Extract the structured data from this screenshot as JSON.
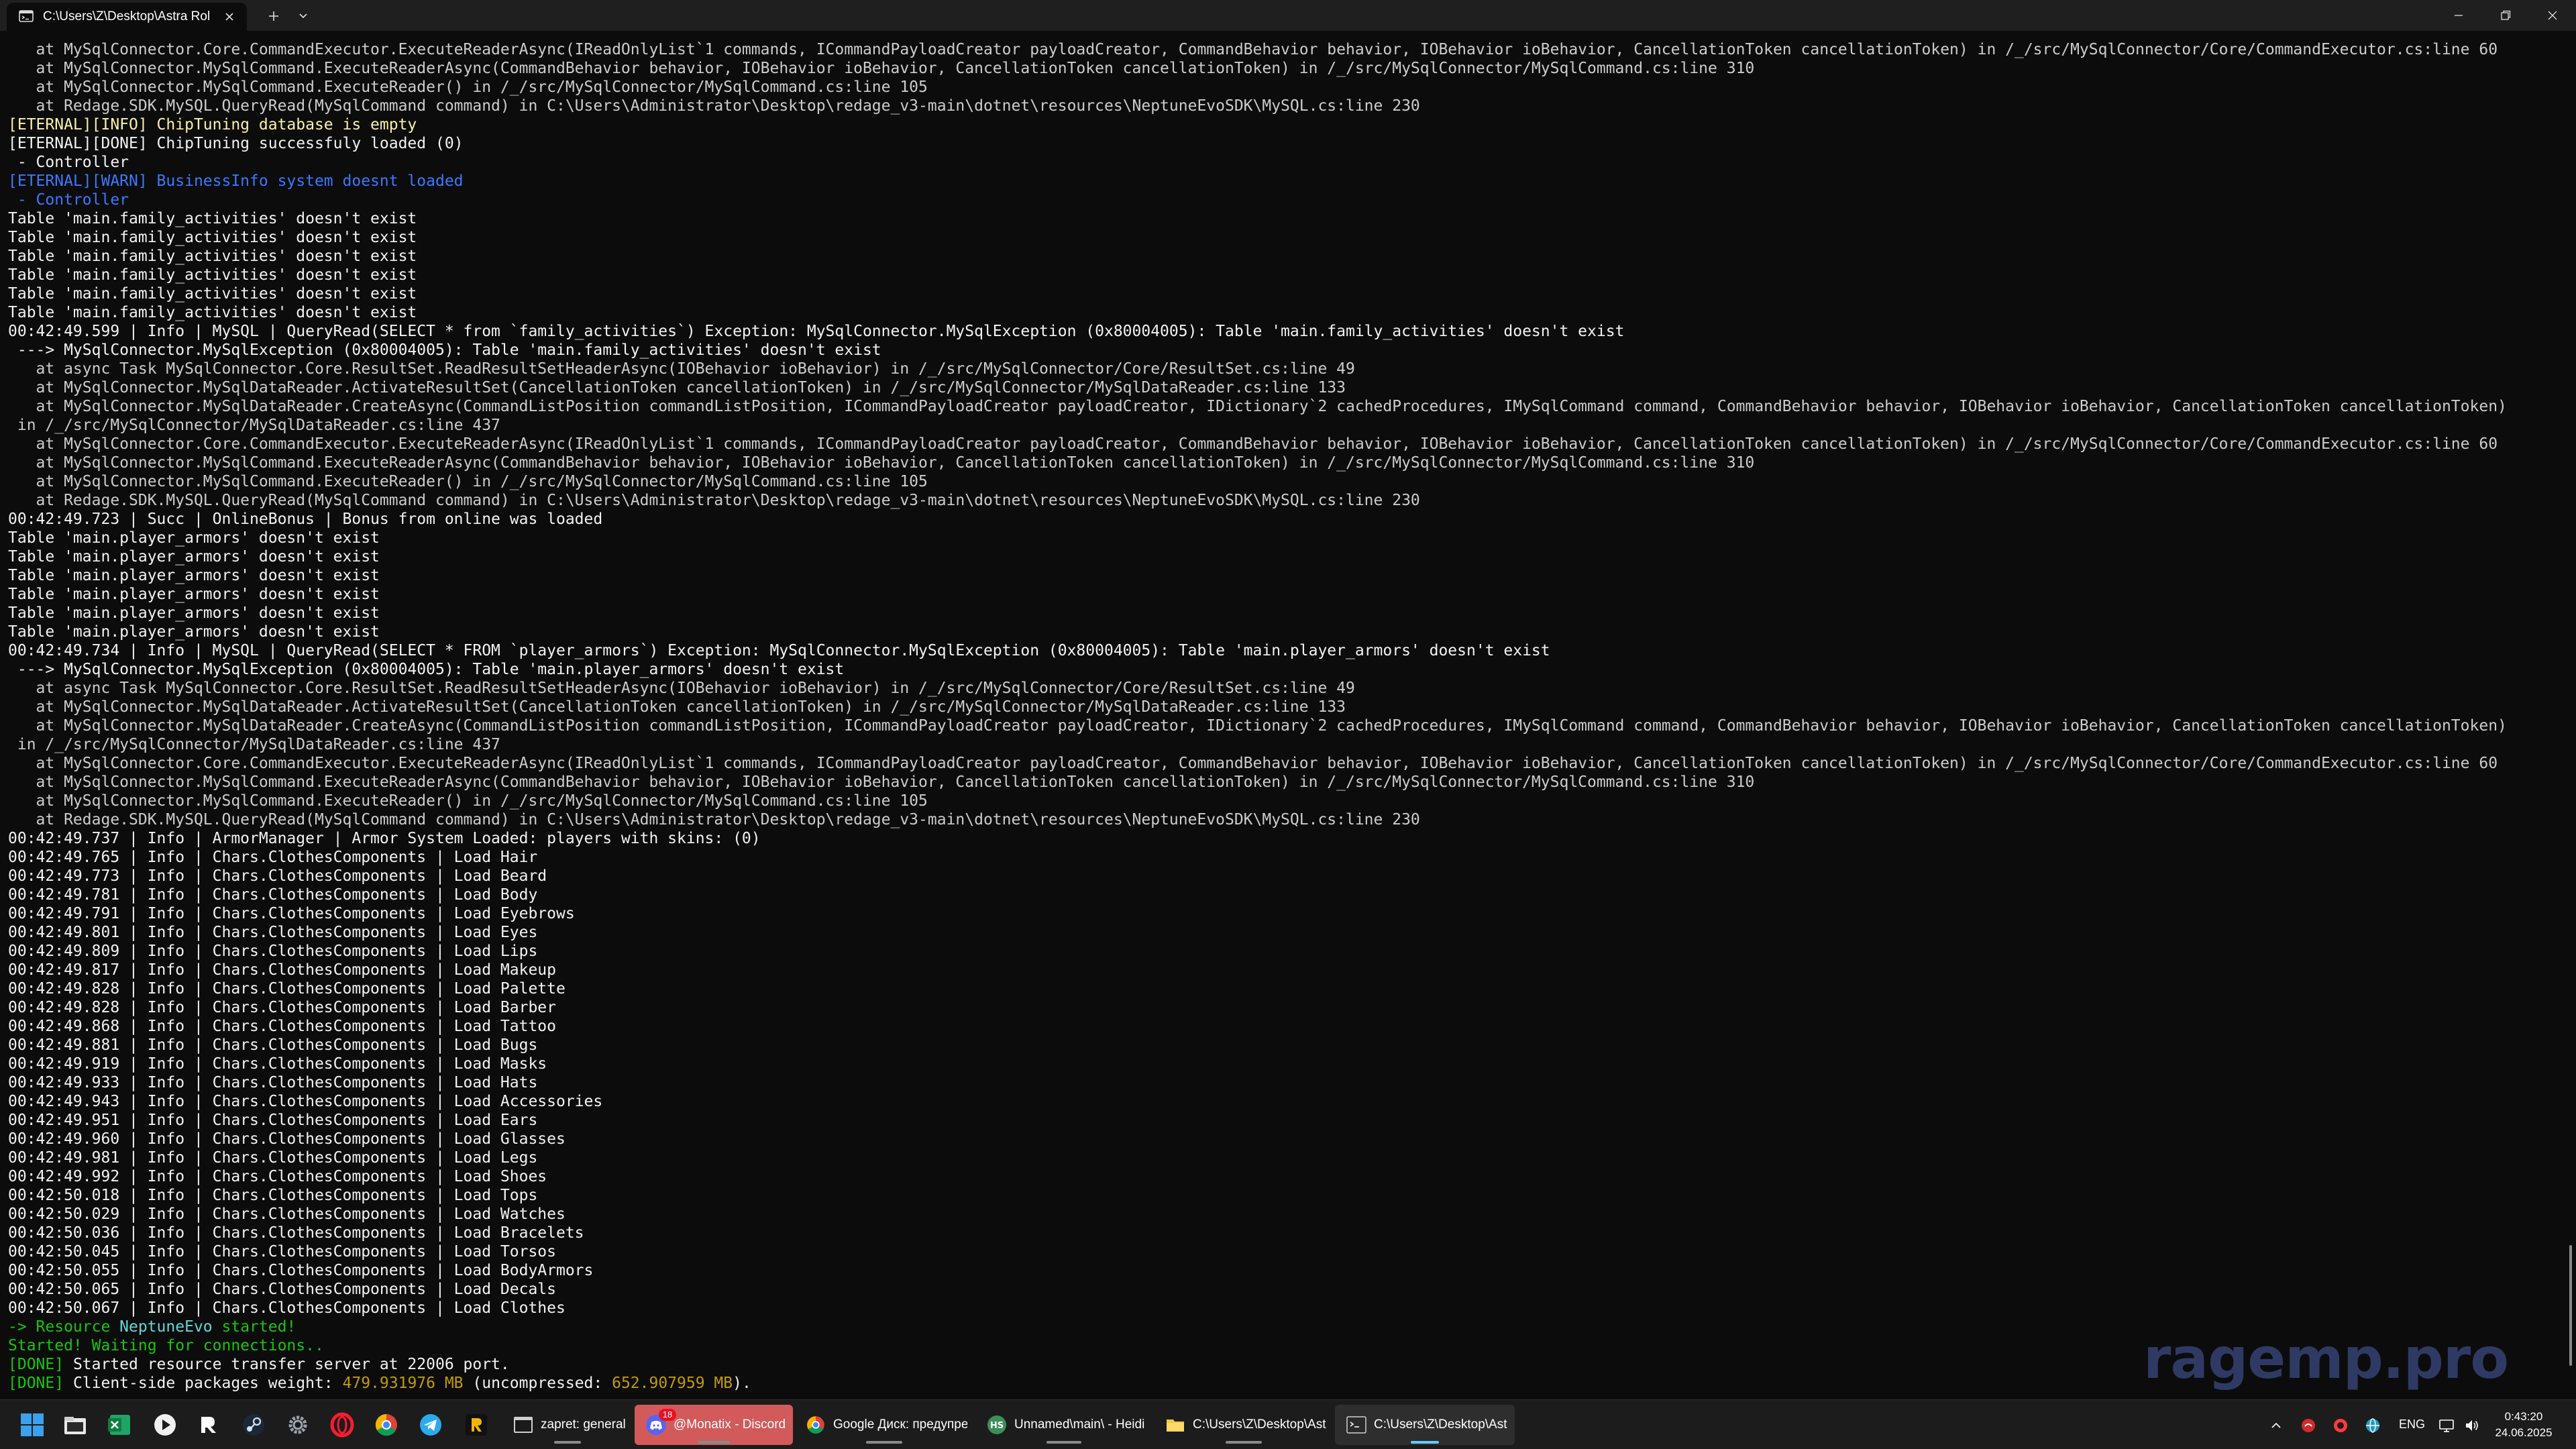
{
  "window": {
    "tab_title": "C:\\Users\\Z\\Desktop\\Astra Rol",
    "tab_icon": "terminal-icon"
  },
  "console": {
    "lines": [
      {
        "c": "default",
        "t": "   at MySqlConnector.Core.CommandExecutor.ExecuteReaderAsync(IReadOnlyList`1 commands, ICommandPayloadCreator payloadCreator, CommandBehavior behavior, IOBehavior ioBehavior, CancellationToken cancellationToken) in /_/src/MySqlConnector/Core/CommandExecutor.cs:line 60"
      },
      {
        "c": "default",
        "t": "   at MySqlConnector.MySqlCommand.ExecuteReaderAsync(CommandBehavior behavior, IOBehavior ioBehavior, CancellationToken cancellationToken) in /_/src/MySqlConnector/MySqlCommand.cs:line 310"
      },
      {
        "c": "default",
        "t": "   at MySqlConnector.MySqlCommand.ExecuteReader() in /_/src/MySqlConnector/MySqlCommand.cs:line 105"
      },
      {
        "c": "default",
        "t": "   at Redage.SDK.MySQL.QueryRead(MySqlCommand command) in C:\\Users\\Administrator\\Desktop\\redage_v3-main\\dotnet\\resources\\NeptuneEvoSDK\\MySQL.cs:line 230"
      },
      {
        "c": "yellow",
        "t": "[ETERNAL][INFO] ChipTuning database is empty"
      },
      {
        "c": "white",
        "t": "[ETERNAL][DONE] ChipTuning successfuly loaded (0)"
      },
      {
        "c": "white",
        "t": " - Controller"
      },
      {
        "c": "blue",
        "t": "[ETERNAL][WARN] BusinessInfo system doesnt loaded"
      },
      {
        "c": "blue",
        "t": " - Controller"
      },
      {
        "c": "white",
        "t": "Table 'main.family_activities' doesn't exist"
      },
      {
        "c": "white",
        "t": "Table 'main.family_activities' doesn't exist"
      },
      {
        "c": "white",
        "t": "Table 'main.family_activities' doesn't exist"
      },
      {
        "c": "white",
        "t": "Table 'main.family_activities' doesn't exist"
      },
      {
        "c": "white",
        "t": "Table 'main.family_activities' doesn't exist"
      },
      {
        "c": "white",
        "t": "Table 'main.family_activities' doesn't exist"
      },
      {
        "c": "white",
        "t": "00:42:49.599 | Info | MySQL | QueryRead(SELECT * from `family_activities`) Exception: MySqlConnector.MySqlException (0x80004005): Table 'main.family_activities' doesn't exist"
      },
      {
        "c": "white",
        "t": " ---> MySqlConnector.MySqlException (0x80004005): Table 'main.family_activities' doesn't exist"
      },
      {
        "c": "default",
        "t": "   at async Task MySqlConnector.Core.ResultSet.ReadResultSetHeaderAsync(IOBehavior ioBehavior) in /_/src/MySqlConnector/Core/ResultSet.cs:line 49"
      },
      {
        "c": "default",
        "t": "   at MySqlConnector.MySqlDataReader.ActivateResultSet(CancellationToken cancellationToken) in /_/src/MySqlConnector/MySqlDataReader.cs:line 133"
      },
      {
        "c": "default",
        "t": "   at MySqlConnector.MySqlDataReader.CreateAsync(CommandListPosition commandListPosition, ICommandPayloadCreator payloadCreator, IDictionary`2 cachedProcedures, IMySqlCommand command, CommandBehavior behavior, IOBehavior ioBehavior, CancellationToken cancellationToken)"
      },
      {
        "c": "default",
        "t": " in /_/src/MySqlConnector/MySqlDataReader.cs:line 437"
      },
      {
        "c": "default",
        "t": "   at MySqlConnector.Core.CommandExecutor.ExecuteReaderAsync(IReadOnlyList`1 commands, ICommandPayloadCreator payloadCreator, CommandBehavior behavior, IOBehavior ioBehavior, CancellationToken cancellationToken) in /_/src/MySqlConnector/Core/CommandExecutor.cs:line 60"
      },
      {
        "c": "default",
        "t": "   at MySqlConnector.MySqlCommand.ExecuteReaderAsync(CommandBehavior behavior, IOBehavior ioBehavior, CancellationToken cancellationToken) in /_/src/MySqlConnector/MySqlCommand.cs:line 310"
      },
      {
        "c": "default",
        "t": "   at MySqlConnector.MySqlCommand.ExecuteReader() in /_/src/MySqlConnector/MySqlCommand.cs:line 105"
      },
      {
        "c": "default",
        "t": "   at Redage.SDK.MySQL.QueryRead(MySqlCommand command) in C:\\Users\\Administrator\\Desktop\\redage_v3-main\\dotnet\\resources\\NeptuneEvoSDK\\MySQL.cs:line 230"
      },
      {
        "c": "white",
        "t": "00:42:49.723 | Succ | OnlineBonus | Bonus from online was loaded"
      },
      {
        "c": "white",
        "t": "Table 'main.player_armors' doesn't exist"
      },
      {
        "c": "white",
        "t": "Table 'main.player_armors' doesn't exist"
      },
      {
        "c": "white",
        "t": "Table 'main.player_armors' doesn't exist"
      },
      {
        "c": "white",
        "t": "Table 'main.player_armors' doesn't exist"
      },
      {
        "c": "white",
        "t": "Table 'main.player_armors' doesn't exist"
      },
      {
        "c": "white",
        "t": "Table 'main.player_armors' doesn't exist"
      },
      {
        "c": "white",
        "t": "00:42:49.734 | Info | MySQL | QueryRead(SELECT * FROM `player_armors`) Exception: MySqlConnector.MySqlException (0x80004005): Table 'main.player_armors' doesn't exist"
      },
      {
        "c": "white",
        "t": " ---> MySqlConnector.MySqlException (0x80004005): Table 'main.player_armors' doesn't exist"
      },
      {
        "c": "default",
        "t": "   at async Task MySqlConnector.Core.ResultSet.ReadResultSetHeaderAsync(IOBehavior ioBehavior) in /_/src/MySqlConnector/Core/ResultSet.cs:line 49"
      },
      {
        "c": "default",
        "t": "   at MySqlConnector.MySqlDataReader.ActivateResultSet(CancellationToken cancellationToken) in /_/src/MySqlConnector/MySqlDataReader.cs:line 133"
      },
      {
        "c": "default",
        "t": "   at MySqlConnector.MySqlDataReader.CreateAsync(CommandListPosition commandListPosition, ICommandPayloadCreator payloadCreator, IDictionary`2 cachedProcedures, IMySqlCommand command, CommandBehavior behavior, IOBehavior ioBehavior, CancellationToken cancellationToken)"
      },
      {
        "c": "default",
        "t": " in /_/src/MySqlConnector/MySqlDataReader.cs:line 437"
      },
      {
        "c": "default",
        "t": "   at MySqlConnector.Core.CommandExecutor.ExecuteReaderAsync(IReadOnlyList`1 commands, ICommandPayloadCreator payloadCreator, CommandBehavior behavior, IOBehavior ioBehavior, CancellationToken cancellationToken) in /_/src/MySqlConnector/Core/CommandExecutor.cs:line 60"
      },
      {
        "c": "default",
        "t": "   at MySqlConnector.MySqlCommand.ExecuteReaderAsync(CommandBehavior behavior, IOBehavior ioBehavior, CancellationToken cancellationToken) in /_/src/MySqlConnector/MySqlCommand.cs:line 310"
      },
      {
        "c": "default",
        "t": "   at MySqlConnector.MySqlCommand.ExecuteReader() in /_/src/MySqlConnector/MySqlCommand.cs:line 105"
      },
      {
        "c": "default",
        "t": "   at Redage.SDK.MySQL.QueryRead(MySqlCommand command) in C:\\Users\\Administrator\\Desktop\\redage_v3-main\\dotnet\\resources\\NeptuneEvoSDK\\MySQL.cs:line 230"
      },
      {
        "c": "white",
        "t": "00:42:49.737 | Info | ArmorManager | Armor System Loaded: players with skins: (0)"
      },
      {
        "c": "white",
        "t": "00:42:49.765 | Info | Chars.ClothesComponents | Load Hair"
      },
      {
        "c": "white",
        "t": "00:42:49.773 | Info | Chars.ClothesComponents | Load Beard"
      },
      {
        "c": "white",
        "t": "00:42:49.781 | Info | Chars.ClothesComponents | Load Body"
      },
      {
        "c": "white",
        "t": "00:42:49.791 | Info | Chars.ClothesComponents | Load Eyebrows"
      },
      {
        "c": "white",
        "t": "00:42:49.801 | Info | Chars.ClothesComponents | Load Eyes"
      },
      {
        "c": "white",
        "t": "00:42:49.809 | Info | Chars.ClothesComponents | Load Lips"
      },
      {
        "c": "white",
        "t": "00:42:49.817 | Info | Chars.ClothesComponents | Load Makeup"
      },
      {
        "c": "white",
        "t": "00:42:49.828 | Info | Chars.ClothesComponents | Load Palette"
      },
      {
        "c": "white",
        "t": "00:42:49.828 | Info | Chars.ClothesComponents | Load Barber"
      },
      {
        "c": "white",
        "t": "00:42:49.868 | Info | Chars.ClothesComponents | Load Tattoo"
      },
      {
        "c": "white",
        "t": "00:42:49.881 | Info | Chars.ClothesComponents | Load Bugs"
      },
      {
        "c": "white",
        "t": "00:42:49.919 | Info | Chars.ClothesComponents | Load Masks"
      },
      {
        "c": "white",
        "t": "00:42:49.933 | Info | Chars.ClothesComponents | Load Hats"
      },
      {
        "c": "white",
        "t": "00:42:49.943 | Info | Chars.ClothesComponents | Load Accessories"
      },
      {
        "c": "white",
        "t": "00:42:49.951 | Info | Chars.ClothesComponents | Load Ears"
      },
      {
        "c": "white",
        "t": "00:42:49.960 | Info | Chars.ClothesComponents | Load Glasses"
      },
      {
        "c": "white",
        "t": "00:42:49.981 | Info | Chars.ClothesComponents | Load Legs"
      },
      {
        "c": "white",
        "t": "00:42:49.992 | Info | Chars.ClothesComponents | Load Shoes"
      },
      {
        "c": "white",
        "t": "00:42:50.018 | Info | Chars.ClothesComponents | Load Tops"
      },
      {
        "c": "white",
        "t": "00:42:50.029 | Info | Chars.ClothesComponents | Load Watches"
      },
      {
        "c": "white",
        "t": "00:42:50.036 | Info | Chars.ClothesComponents | Load Bracelets"
      },
      {
        "c": "white",
        "t": "00:42:50.045 | Info | Chars.ClothesComponents | Load Torsos"
      },
      {
        "c": "white",
        "t": "00:42:50.055 | Info | Chars.ClothesComponents | Load BodyArmors"
      },
      {
        "c": "white",
        "t": "00:42:50.065 | Info | Chars.ClothesComponents | Load Decals"
      },
      {
        "c": "white",
        "t": "00:42:50.067 | Info | Chars.ClothesComponents | Load Clothes"
      },
      {
        "segments": [
          {
            "c": "green",
            "t": "-> Resource "
          },
          {
            "c": "cyan",
            "t": "NeptuneEvo"
          },
          {
            "c": "green",
            "t": " started!"
          }
        ]
      },
      {
        "c": "green",
        "t": "Started! Waiting for connections.."
      },
      {
        "segments": [
          {
            "c": "green",
            "t": "[DONE] "
          },
          {
            "c": "white",
            "t": "Started resource transfer server at 22006 port."
          }
        ]
      },
      {
        "segments": [
          {
            "c": "green",
            "t": "[DONE] "
          },
          {
            "c": "white",
            "t": "Client-side packages weight: "
          },
          {
            "c": "gold",
            "t": "479.931976 MB"
          },
          {
            "c": "white",
            "t": " (uncompressed: "
          },
          {
            "c": "gold",
            "t": "652.907959 MB"
          },
          {
            "c": "white",
            "t": ")."
          }
        ]
      }
    ]
  },
  "watermark": "ragemp.pro",
  "taskbar": {
    "pinned": [
      "windows-start-icon",
      "file-explorer-icon",
      "excel-icon",
      "media-player-icon",
      "rockstar-icon",
      "steam-icon",
      "settings-icon",
      "opera-icon",
      "chrome-icon",
      "telegram-icon",
      "rage-mp-icon"
    ],
    "apps": [
      {
        "label": "zapret: general",
        "icon": "cmd-window-icon"
      },
      {
        "label": "@Monatix - Discord",
        "icon": "discord-icon",
        "badge": "18"
      },
      {
        "label": "Google Диск: предупре",
        "icon": "chrome-icon"
      },
      {
        "label": "Unnamed\\main\\ - Heidi",
        "icon": "heidisql-icon"
      },
      {
        "label": "C:\\Users\\Z\\Desktop\\Ast",
        "icon": "folder-icon"
      },
      {
        "label": "C:\\Users\\Z\\Desktop\\Ast",
        "icon": "terminal-icon"
      }
    ],
    "tray": {
      "lang": "ENG",
      "time": "0:43:20",
      "date": "24.06.2025"
    }
  },
  "colors": {
    "console_bg": "#0c0c0c",
    "default": "#cccccc",
    "white": "#f2f2f2",
    "yellow": "#f9f1a5",
    "blue": "#3b78ff",
    "green": "#16c60c",
    "gold": "#c19c00",
    "cyan": "#61d6d6",
    "taskbar_bg": "#1c1c1c",
    "accent": "#60cdff"
  }
}
